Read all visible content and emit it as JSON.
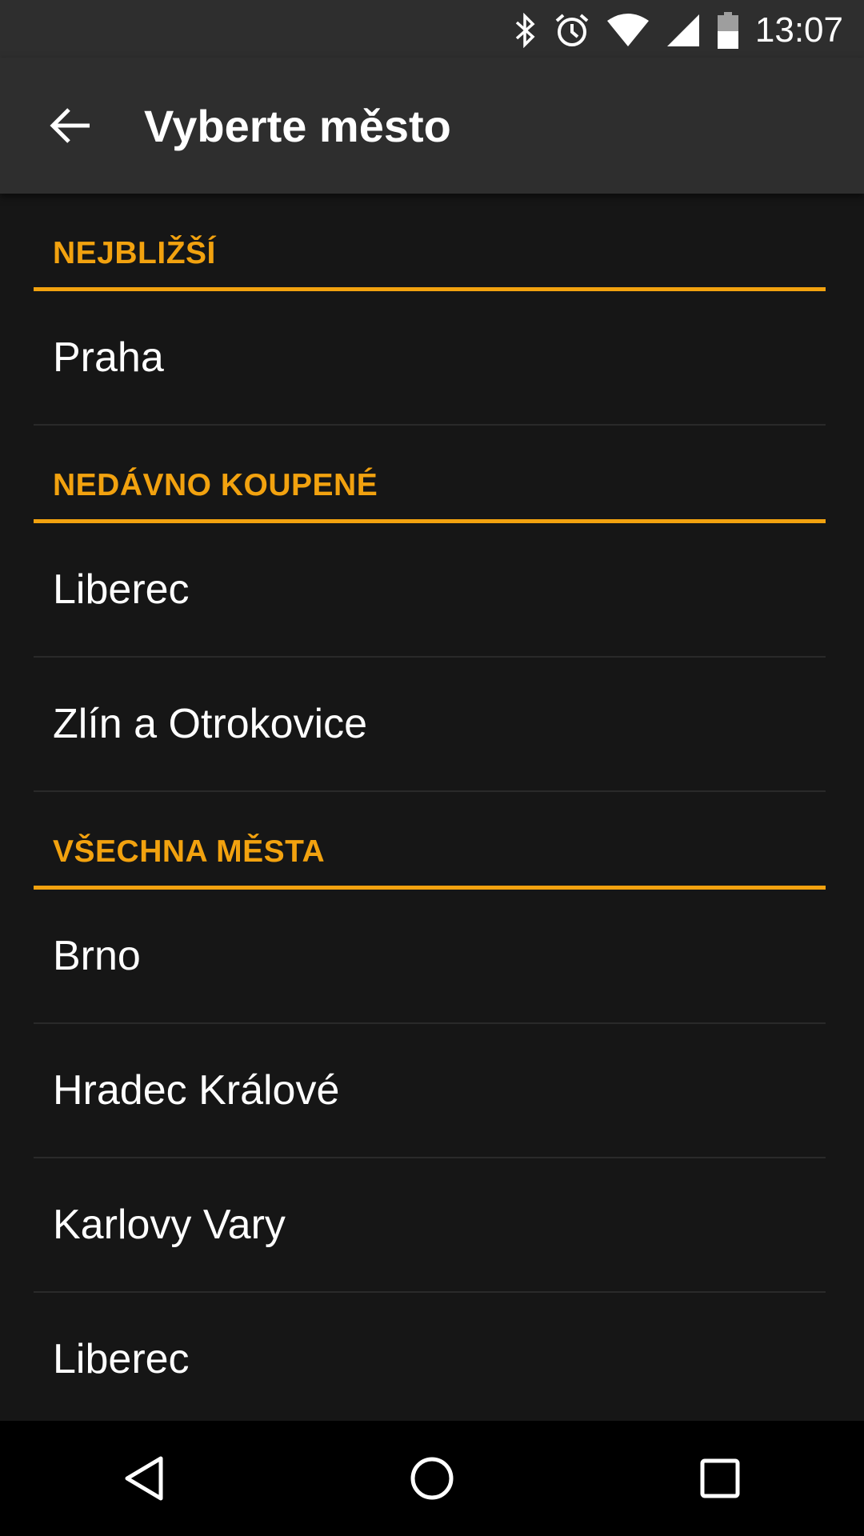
{
  "status_bar": {
    "time": "13:07",
    "icons": [
      "bluetooth-icon",
      "alarm-icon",
      "wifi-icon",
      "cell-signal-icon",
      "battery-icon"
    ]
  },
  "app_bar": {
    "title": "Vyberte město",
    "back_icon": "arrow-back-icon"
  },
  "sections": [
    {
      "header": "NEJBLIŽŠÍ",
      "items": [
        "Praha"
      ]
    },
    {
      "header": "NEDÁVNO KOUPENÉ",
      "items": [
        "Liberec",
        "Zlín a Otrokovice"
      ]
    },
    {
      "header": "VŠECHNA MĚSTA",
      "items": [
        "Brno",
        "Hradec Králové",
        "Karlovy Vary",
        "Liberec"
      ]
    }
  ],
  "nav_bar": {
    "buttons": [
      "nav-back-icon",
      "nav-home-icon",
      "nav-recents-icon"
    ]
  },
  "colors": {
    "accent": "#f2a20f",
    "app_bar": "#2e2e2e",
    "background": "#161616",
    "nav_bar": "#000000"
  }
}
